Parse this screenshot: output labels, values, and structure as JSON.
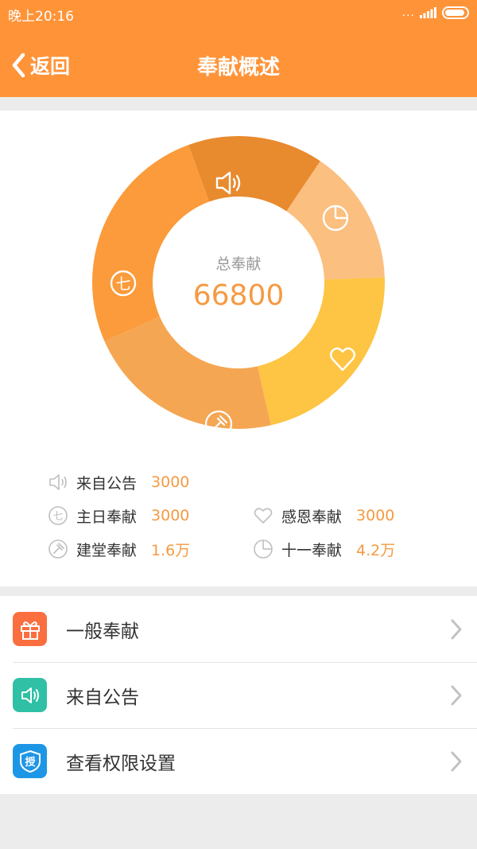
{
  "status": {
    "time": "晚上20:16",
    "dots": "..."
  },
  "header": {
    "back_label": "返回",
    "title": "奉献概述"
  },
  "summary": {
    "total_label": "总奉献",
    "total_value": "66800"
  },
  "legend": [
    {
      "label": "来自公告",
      "value": "3000"
    },
    {
      "label": "主日奉献",
      "value": "3000"
    },
    {
      "label": "感恩奉献",
      "value": "3000"
    },
    {
      "label": "建堂奉献",
      "value": "1.6万"
    },
    {
      "label": "十一奉献",
      "value": "4.2万"
    }
  ],
  "menu": [
    {
      "label": "一般奉献",
      "icon": "gift-icon",
      "color": "#fb6e3f"
    },
    {
      "label": "来自公告",
      "icon": "speaker-icon",
      "color": "#2fc0a5"
    },
    {
      "label": "查看权限设置",
      "icon": "authorize-badge-icon",
      "color": "#1e96e6",
      "icon_text": "授"
    }
  ],
  "colors": {
    "header": "#ff9338",
    "accent": "#f59a42"
  },
  "chart_data": {
    "type": "pie",
    "segments": [
      {
        "label": "来自公告",
        "share": 0.15,
        "color": "#e88a2e",
        "icon": "speaker-icon"
      },
      {
        "label": "十一奉献",
        "share": 0.15,
        "color": "#fbbf80",
        "icon": "pie-icon"
      },
      {
        "label": "感恩奉献",
        "share": 0.22,
        "color": "#fec443",
        "icon": "heart-icon"
      },
      {
        "label": "建堂奉献",
        "share": 0.22,
        "color": "#f5a652",
        "icon": "hammer-icon"
      },
      {
        "label": "主日奉献",
        "share": 0.26,
        "color": "#fb9b3b",
        "icon": "seven-icon"
      }
    ]
  }
}
